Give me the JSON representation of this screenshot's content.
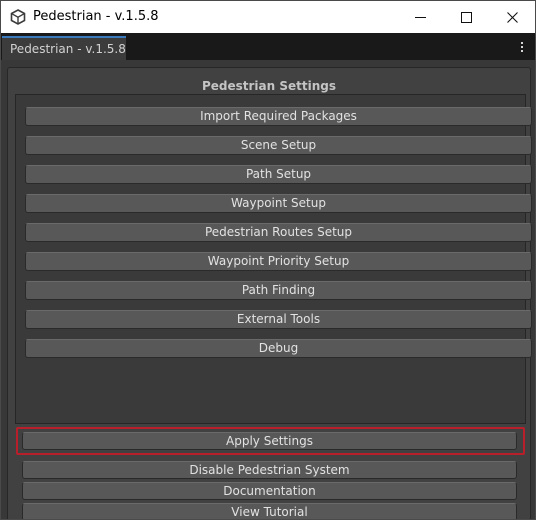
{
  "window": {
    "title": "Pedestrian - v.1.5.8",
    "icon": "unity-logo-icon"
  },
  "tab": {
    "label": "Pedestrian - v.1.5.8",
    "menu_icon": "kebab-menu-icon"
  },
  "panel": {
    "title": "Pedestrian Settings",
    "menu_buttons": [
      "Import Required Packages",
      "Scene Setup",
      "Path Setup",
      "Waypoint Setup",
      "Pedestrian Routes Setup",
      "Waypoint Priority Setup",
      "Path Finding",
      "External Tools",
      "Debug"
    ],
    "bottom_buttons": [
      "Apply Settings",
      "Disable Pedestrian System",
      "Documentation",
      "View Tutorial"
    ]
  },
  "colors": {
    "accent_tab": "#3a79bb",
    "highlight": "#b81f2a",
    "background": "#383838",
    "button": "#585858"
  }
}
